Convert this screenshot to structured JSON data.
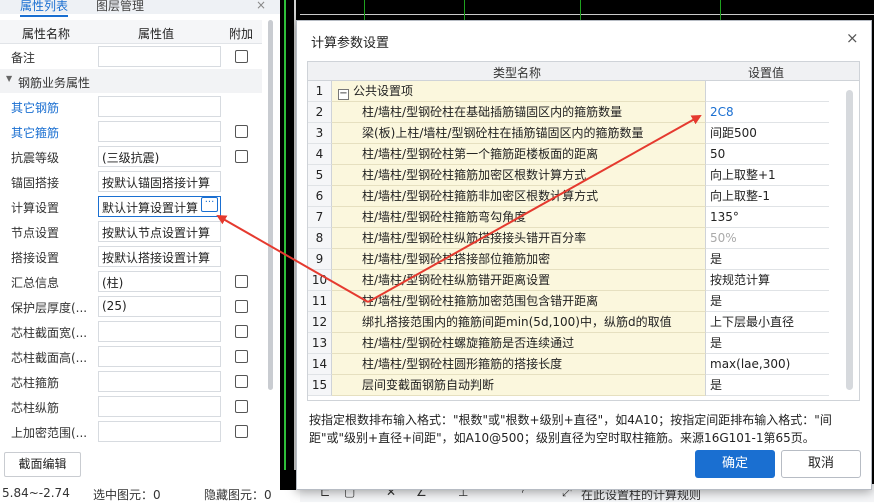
{
  "left_panel": {
    "tabs": [
      "属性列表",
      "图层管理"
    ],
    "close": "×",
    "headers": {
      "name": "属性名称",
      "value": "属性值",
      "extra": "附加"
    },
    "section": "钢筋业务属性",
    "rows": [
      {
        "name": "备注",
        "value": "",
        "checkbox": true,
        "blue": false
      },
      {
        "name": "其它钢筋",
        "value": "",
        "checkbox": false,
        "blue": true
      },
      {
        "name": "其它箍筋",
        "value": "",
        "checkbox": true,
        "blue": true
      },
      {
        "name": "抗震等级",
        "value": "(三级抗震)",
        "checkbox": true,
        "blue": false
      },
      {
        "name": "锚固搭接",
        "value": "按默认锚固搭接计算",
        "checkbox": false,
        "blue": false
      },
      {
        "name": "计算设置",
        "value": "默认计算设置计算",
        "checkbox": false,
        "blue": false
      },
      {
        "name": "节点设置",
        "value": "按默认节点设置计算",
        "checkbox": false,
        "blue": false
      },
      {
        "name": "搭接设置",
        "value": "按默认搭接设置计算",
        "checkbox": false,
        "blue": false
      },
      {
        "name": "汇总信息",
        "value": "(柱)",
        "checkbox": true,
        "blue": false
      },
      {
        "name": "保护层厚度(...",
        "value": "(25)",
        "checkbox": true,
        "blue": false
      },
      {
        "name": "芯柱截面宽(...",
        "value": "",
        "checkbox": true,
        "blue": false
      },
      {
        "name": "芯柱截面高(...",
        "value": "",
        "checkbox": true,
        "blue": false
      },
      {
        "name": "芯柱箍筋",
        "value": "",
        "checkbox": true,
        "blue": false
      },
      {
        "name": "芯柱纵筋",
        "value": "",
        "checkbox": true,
        "blue": false
      },
      {
        "name": "上加密范围(...",
        "value": "",
        "checkbox": true,
        "blue": false
      }
    ],
    "dots_button": "···",
    "section_edit_button": "截面编辑"
  },
  "status_bar": {
    "coords": "5.84~-2.74",
    "selected": "选中图元：0",
    "hidden": "隐藏图元：0",
    "hint": "在此设置柱的计算规则"
  },
  "dialog": {
    "title": "计算参数设置",
    "close": "×",
    "columns": {
      "name": "类型名称",
      "value": "设置值"
    },
    "group": {
      "num": "1",
      "minus": "−",
      "name": "公共设置项"
    },
    "rows": [
      {
        "num": "2",
        "name": "柱/墙柱/型钢砼柱在基础插筋锚固区内的箍筋数量",
        "value": "2C8",
        "style": "blue"
      },
      {
        "num": "3",
        "name": "梁(板)上柱/墙柱/型钢砼柱在插筋锚固区内的箍筋数量",
        "value": "间距500",
        "style": ""
      },
      {
        "num": "4",
        "name": "柱/墙柱/型钢砼柱第一个箍筋距楼板面的距离",
        "value": "50",
        "style": ""
      },
      {
        "num": "5",
        "name": "柱/墙柱/型钢砼柱箍筋加密区根数计算方式",
        "value": "向上取整+1",
        "style": ""
      },
      {
        "num": "6",
        "name": "柱/墙柱/型钢砼柱箍筋非加密区根数计算方式",
        "value": "向上取整-1",
        "style": ""
      },
      {
        "num": "7",
        "name": "柱/墙柱/型钢砼柱箍筋弯勾角度",
        "value": "135°",
        "style": ""
      },
      {
        "num": "8",
        "name": "柱/墙柱/型钢砼柱纵筋搭接接头错开百分率",
        "value": "50%",
        "style": "grey"
      },
      {
        "num": "9",
        "name": "柱/墙柱/型钢砼柱搭接部位箍筋加密",
        "value": "是",
        "style": ""
      },
      {
        "num": "10",
        "name": "柱/墙柱/型钢砼柱纵筋错开距离设置",
        "value": "按规范计算",
        "style": ""
      },
      {
        "num": "11",
        "name": "柱/墙柱/型钢砼柱箍筋加密范围包含错开距离",
        "value": "是",
        "style": ""
      },
      {
        "num": "12",
        "name": "绑扎搭接范围内的箍筋间距min(5d,100)中，纵筋d的取值",
        "value": "上下层最小直径",
        "style": ""
      },
      {
        "num": "13",
        "name": "柱/墙柱/型钢砼柱螺旋箍筋是否连续通过",
        "value": "是",
        "style": ""
      },
      {
        "num": "14",
        "name": "柱/墙柱/型钢砼柱圆形箍筋的搭接长度",
        "value": "max(lae,300)",
        "style": ""
      },
      {
        "num": "15",
        "name": "层间变截面钢筋自动判断",
        "value": "是",
        "style": ""
      }
    ],
    "description": "按指定根数排布输入格式：\"根数\"或\"根数+级别+直径\"，如4A10；按指定间距排布输入格式：\"间距\"或\"级别+直径+间距\"，如A10@500；级别直径为空时取柱箍筋。来源16G101-1第65页。",
    "ok": "确定",
    "cancel": "取消"
  },
  "colors": {
    "accent": "#1a6fd1",
    "name_cell_bg": "#fbf7dd",
    "arrow": "#e53a2f",
    "canvas": "#000000"
  }
}
